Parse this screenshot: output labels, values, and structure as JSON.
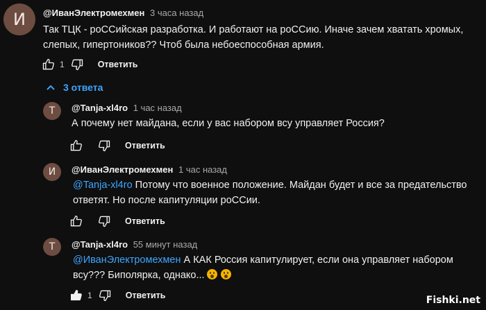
{
  "comment": {
    "avatar_letter": "И",
    "author": "@ИванЭлектромехмен",
    "time": "3 часа назад",
    "text_line1": "Так ТЦК - роССийская разработка. И работают на роССию. Иначе зачем хватать хромых,",
    "text_line2": "слепых, гипертоников?? Чтоб была небоеспособная армия.",
    "like_count": "1",
    "reply_label": "Ответить"
  },
  "replies_toggle": {
    "label": "3 ответа",
    "icon": "chevron-up-icon"
  },
  "replies": [
    {
      "avatar_letter": "T",
      "author": "@Tanja-xl4ro",
      "time": "1 час назад",
      "text_line1": "А почему нет майдана, если у вас набором всу управляет Россия?",
      "like_count": "",
      "reply_label": "Ответить"
    },
    {
      "avatar_letter": "И",
      "author": "@ИванЭлектромехмен",
      "time": "1 час назад",
      "mention": "@Tanja-xl4ro",
      "text_line1": " Потому что военное положение. Майдан будет и все за предательство",
      "text_line2": "ответят. Но после капитуляции роССии.",
      "like_count": "",
      "reply_label": "Ответить"
    },
    {
      "avatar_letter": "T",
      "author": "@Tanja-xl4ro",
      "time": "55 минут назад",
      "mention": "@ИванЭлектромехмен",
      "text_line1": " А КАК Россия капитулирует, если она управляет набором",
      "text_line2": "всу??? Биполярка, однако...",
      "like_count": "1",
      "reply_label": "Ответить"
    }
  ],
  "watermark": "Fishki.net",
  "colors": {
    "background": "#0f0f0f",
    "link": "#3ea6ff",
    "avatar": "#6d4c41"
  }
}
